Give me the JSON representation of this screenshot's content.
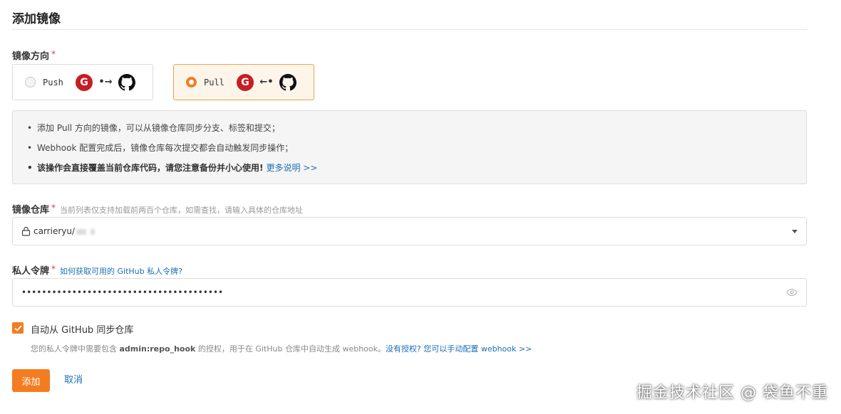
{
  "page": {
    "title": "添加镜像"
  },
  "direction": {
    "label": "镜像方向",
    "required_mark": "*",
    "options": [
      {
        "label": "Push",
        "arrow": "•→",
        "selected": false
      },
      {
        "label": "Pull",
        "arrow": "←•",
        "selected": true
      }
    ],
    "gitee_glyph": "G"
  },
  "info": {
    "bullet": "•",
    "lines": [
      "添加 Pull 方向的镜像，可以从镜像仓库同步分支、标签和提交；",
      "Webhook 配置完成后，镜像仓库每次提交都会自动触发同步操作；",
      "该操作会直接覆盖当前仓库代码，请您注意备份并小心使用!"
    ],
    "more_link": "更多说明 >>"
  },
  "repo": {
    "label": "镜像仓库",
    "required_mark": "*",
    "hint": "当前列表仅支持加载前两百个仓库，如需查找，请输入具体的仓库地址",
    "value": "carrieryu/"
  },
  "token": {
    "label": "私人令牌",
    "required_mark": "*",
    "help_link": "如何获取可用的 GitHub 私人令牌?",
    "value": "••••••••••••••••••••••••••••••••••••••••"
  },
  "auto_sync": {
    "checked": true,
    "label": "自动从 GitHub 同步仓库",
    "hint_prefix": "您的私人令牌中需要包含",
    "hint_scope": "admin:repo_hook",
    "hint_suffix": "的授权，用于在 GitHub 仓库中自动生成 webhook。",
    "hint_link": "没有授权? 您可以手动配置 webhook >>"
  },
  "actions": {
    "submit": "添加",
    "cancel": "取消"
  },
  "watermark": "掘金技术社区 @ 袋鱼不重",
  "colors": {
    "accent": "#f47c20",
    "link": "#1a6fb5",
    "required": "#e4393c",
    "gitee": "#c71d23"
  }
}
